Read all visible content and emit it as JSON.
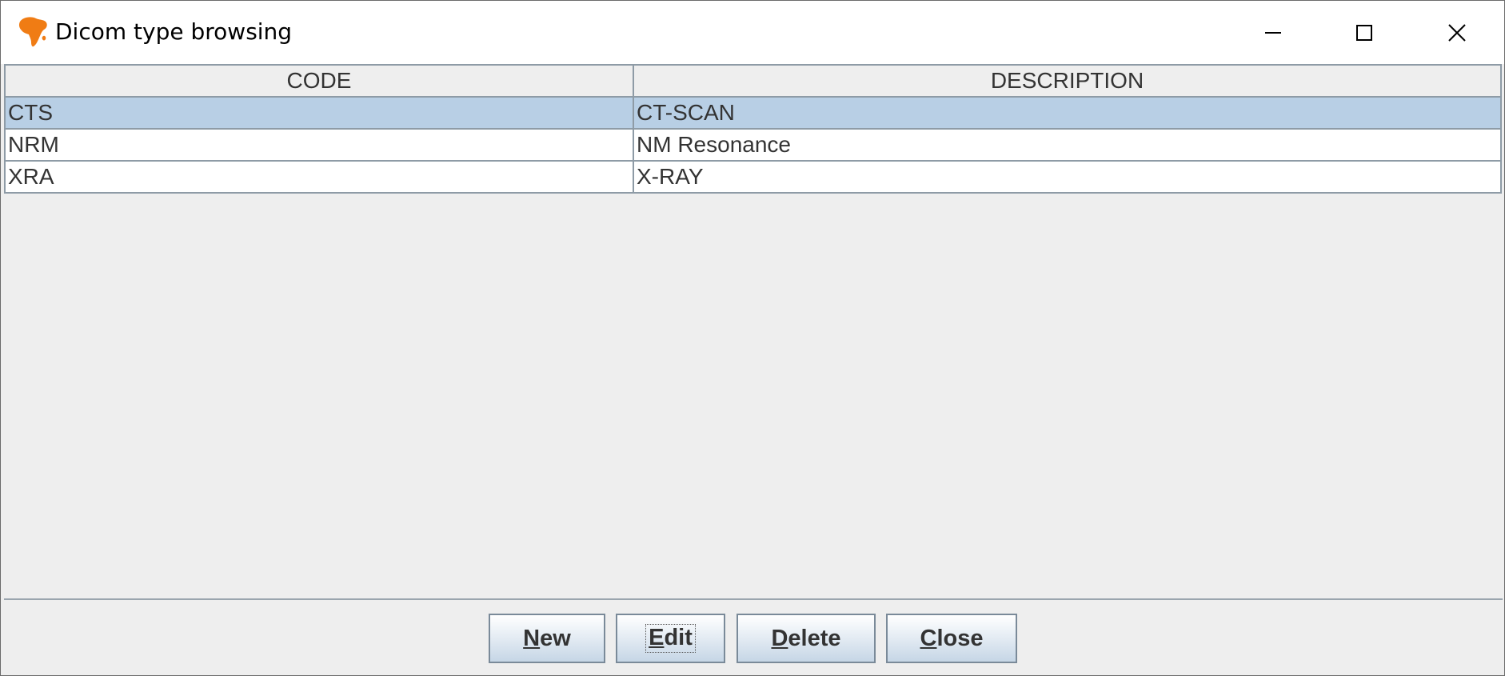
{
  "window": {
    "title": "Dicom type browsing",
    "icon": "africa-map-icon",
    "controls": [
      "minimize-icon",
      "maximize-icon",
      "close-icon"
    ]
  },
  "table": {
    "columns": [
      "CODE",
      "DESCRIPTION"
    ],
    "rows": [
      {
        "code": "CTS",
        "description": "CT-SCAN",
        "selected": true
      },
      {
        "code": "NRM",
        "description": "NM Resonance",
        "selected": false
      },
      {
        "code": "XRA",
        "description": "X-RAY",
        "selected": false
      }
    ]
  },
  "buttons": {
    "new": {
      "mnemonic": "N",
      "rest": "ew"
    },
    "edit": {
      "mnemonic": "E",
      "rest": "dit"
    },
    "delete": {
      "mnemonic": "D",
      "rest": "elete"
    },
    "close": {
      "mnemonic": "C",
      "rest": "lose"
    }
  },
  "colors": {
    "selection": "#b8cfe5",
    "icon": "#f07c14",
    "background": "#eeeeee"
  }
}
